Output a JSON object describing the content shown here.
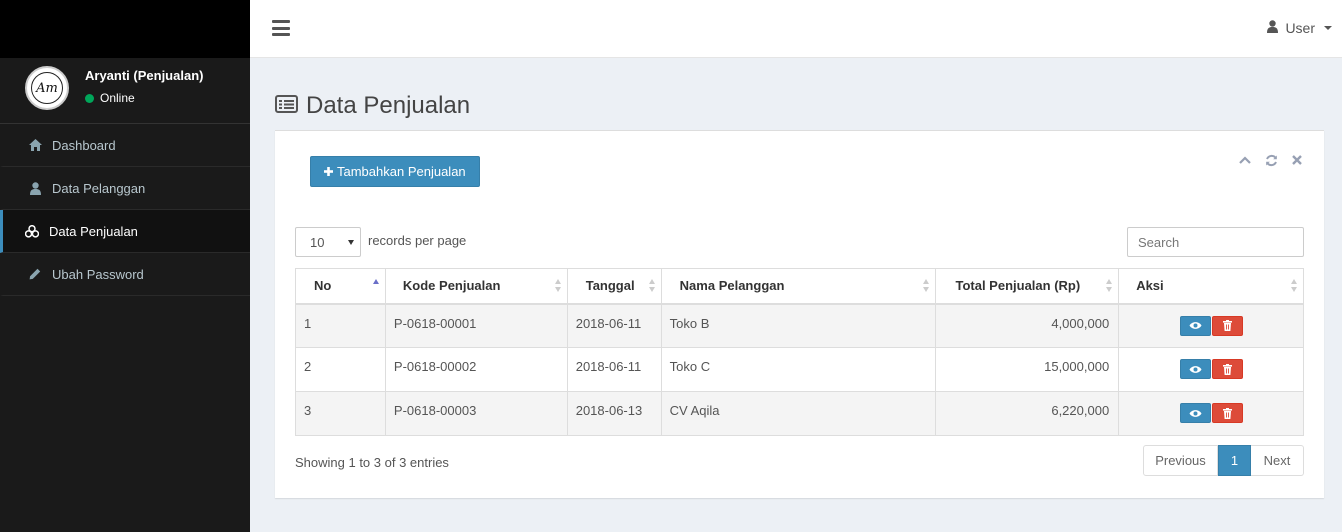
{
  "sidebar": {
    "user": {
      "name": "Aryanti (Penjualan)",
      "status": "Online",
      "avatar_initials": "Am"
    },
    "items": [
      {
        "label": "Dashboard",
        "icon": "home-icon"
      },
      {
        "label": "Data Pelanggan",
        "icon": "user-icon"
      },
      {
        "label": "Data Penjualan",
        "icon": "cubes-icon",
        "active": true
      },
      {
        "label": "Ubah Password",
        "icon": "pencil-icon"
      }
    ]
  },
  "header": {
    "user_label": "User"
  },
  "main": {
    "title": "Data Penjualan",
    "add_button": "Tambahkan Penjualan",
    "records_per_page": {
      "value": "10",
      "label": "records per page"
    },
    "search": {
      "placeholder": "Search",
      "value": ""
    },
    "table": {
      "columns": [
        "No",
        "Kode Penjualan",
        "Tanggal",
        "Nama Pelanggan",
        "Total Penjualan (Rp)",
        "Aksi"
      ],
      "rows": [
        {
          "no": "1",
          "kode": "P-0618-00001",
          "tanggal": "2018-06-11",
          "nama": "Toko B",
          "total": "4,000,000"
        },
        {
          "no": "2",
          "kode": "P-0618-00002",
          "tanggal": "2018-06-11",
          "nama": "Toko C",
          "total": "15,000,000"
        },
        {
          "no": "3",
          "kode": "P-0618-00003",
          "tanggal": "2018-06-13",
          "nama": "CV Aqila",
          "total": "6,220,000"
        }
      ]
    },
    "info": "Showing 1 to 3 of 3 entries",
    "pagination": {
      "previous": "Previous",
      "current": "1",
      "next": "Next"
    }
  },
  "colors": {
    "primary": "#3c8dbc",
    "danger": "#dd4b39",
    "online": "#00a65a",
    "sidebar_bg": "#1a1a1a"
  }
}
